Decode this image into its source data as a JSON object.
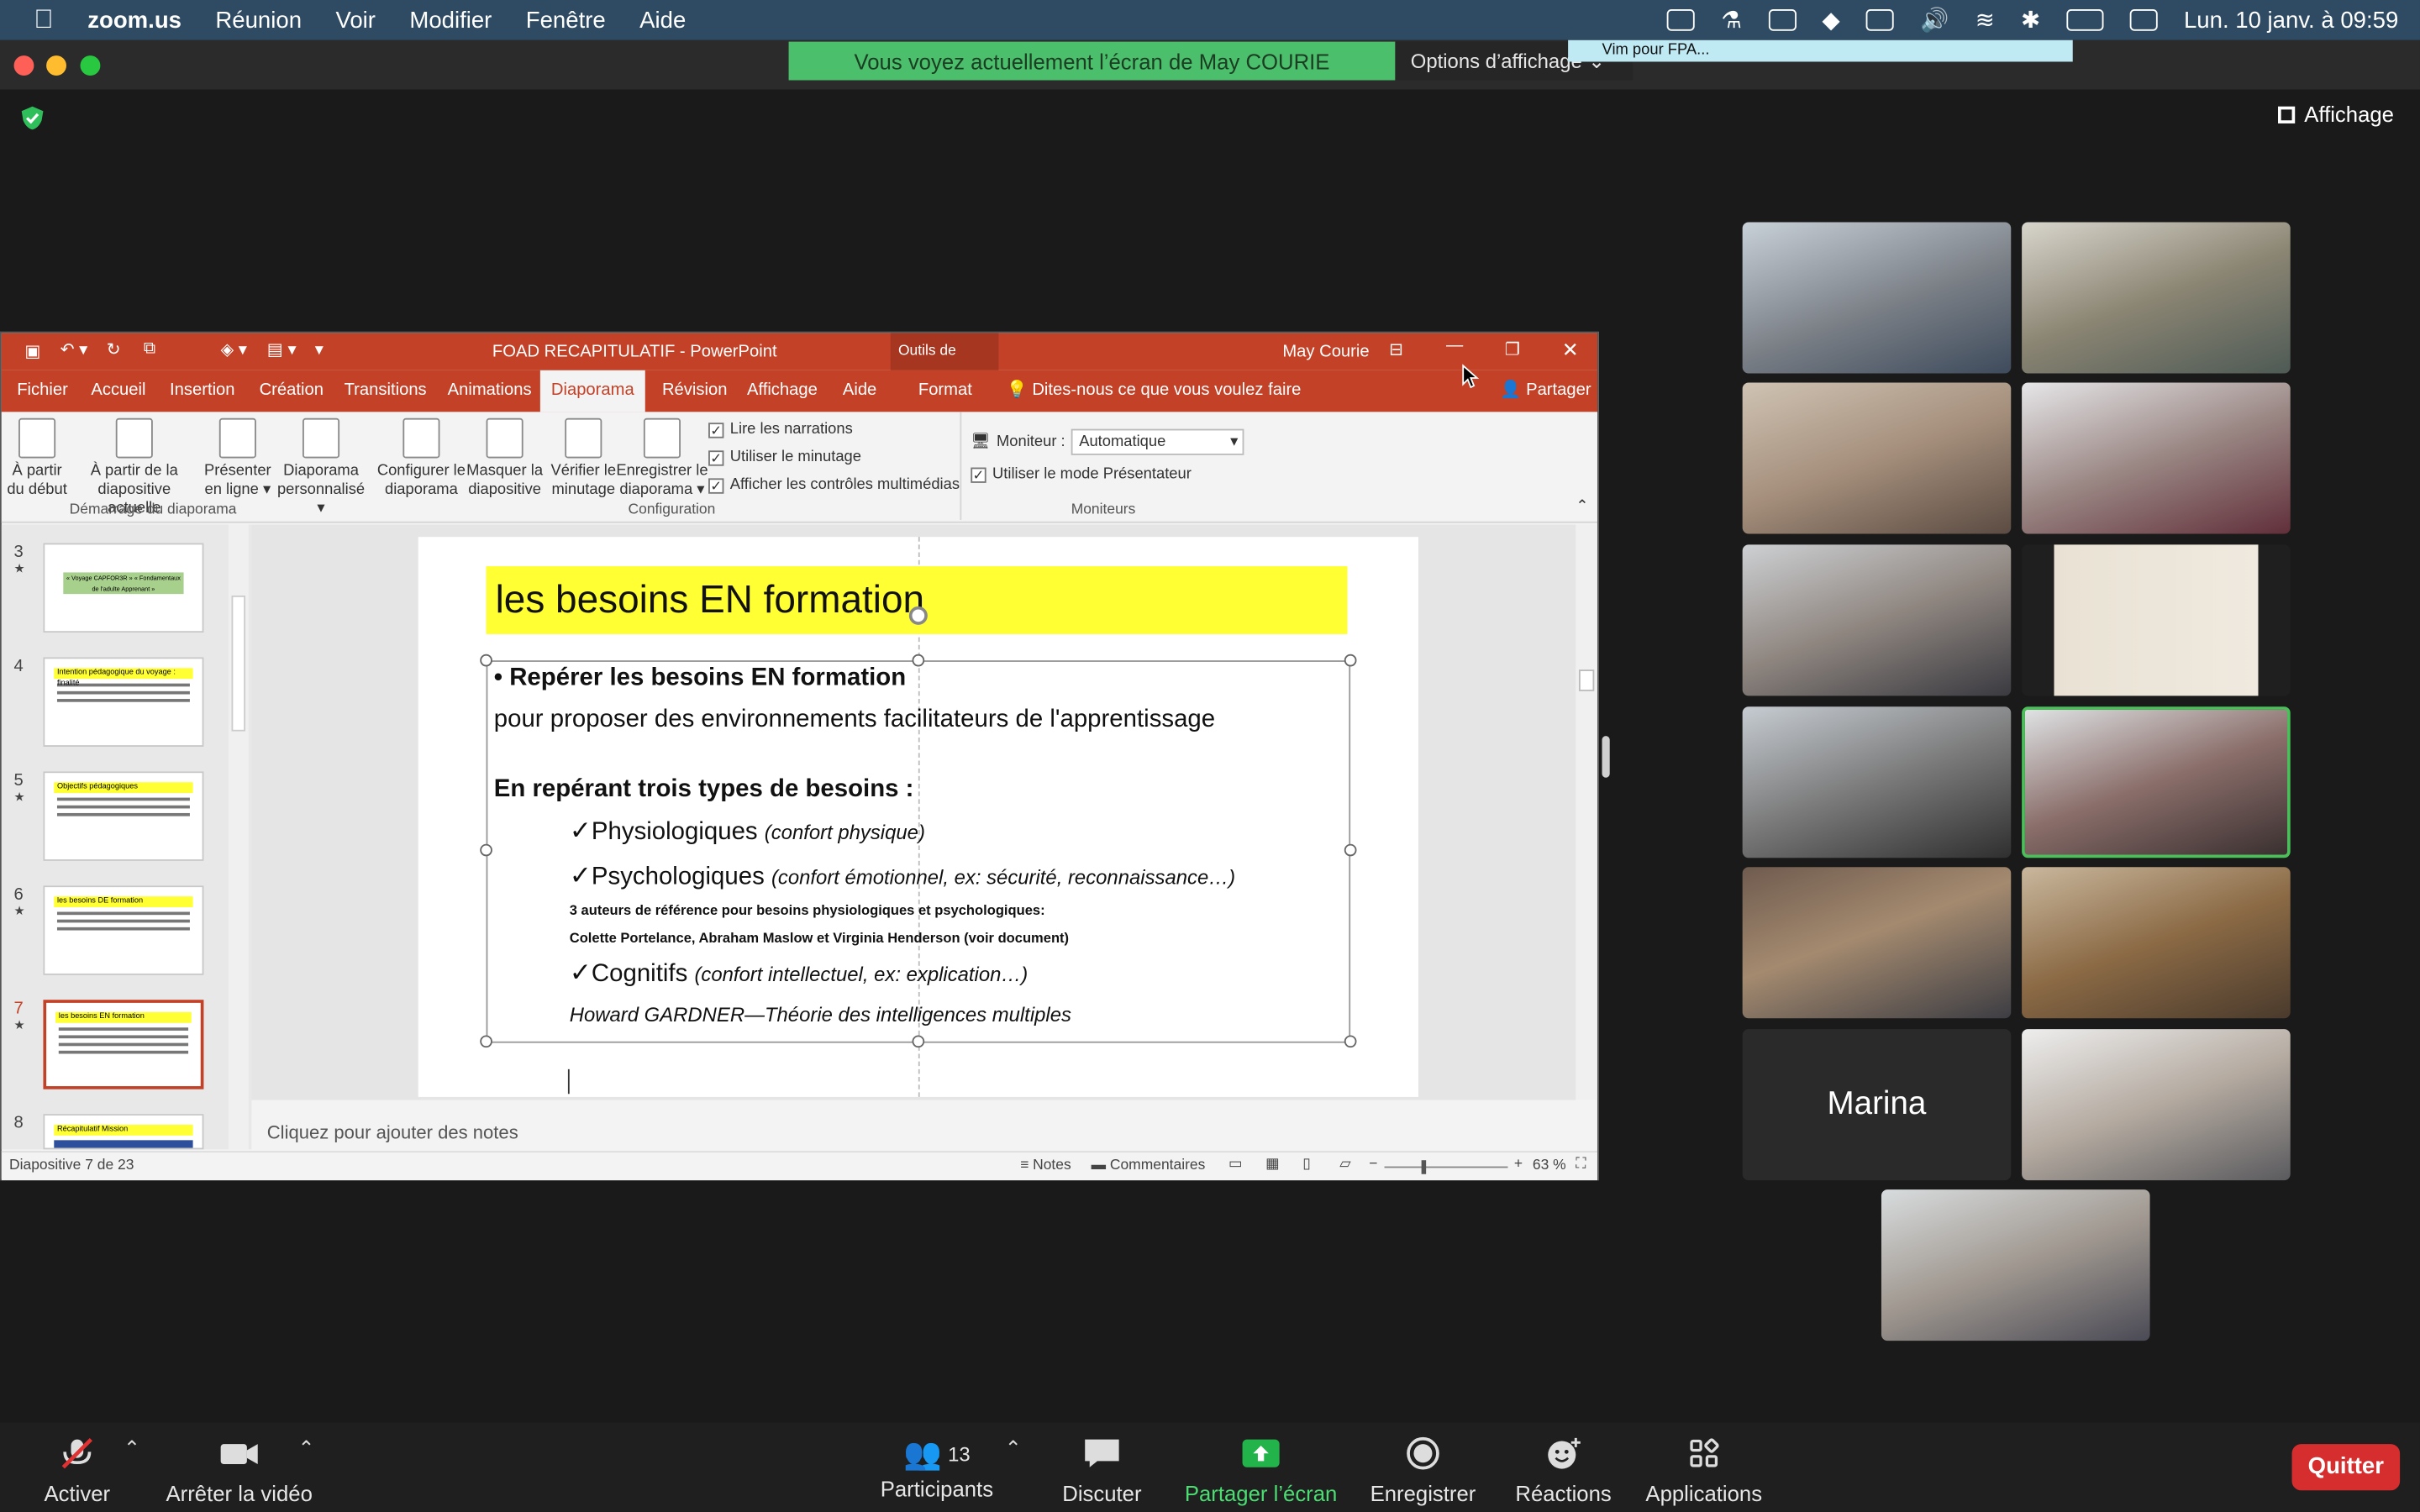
{
  "menubar": {
    "app": "zoom.us",
    "items": [
      "Réunion",
      "Voir",
      "Modifier",
      "Fenêtre",
      "Aide"
    ],
    "clock": "Lun. 10 janv. à  09:59"
  },
  "zoom": {
    "share_banner": "Vous voyez actuellement l’écran de May COURIE",
    "view_options": "Options d’affichage",
    "vim_tooltip": "Vim pour FPA...",
    "view_button": "Affichage",
    "participant_count": "13",
    "named_tile": "Marina",
    "toolbar": {
      "mute": "Activer",
      "video": "Arrêter la vidéo",
      "participants": "Participants",
      "chat": "Discuter",
      "share": "Partager l’écran",
      "record": "Enregistrer",
      "reactions": "Réactions",
      "apps": "Applications",
      "quit": "Quitter"
    }
  },
  "ppt": {
    "title": "FOAD RECAPITULATIF  -  PowerPoint",
    "context_tab": "Outils de dessin",
    "user": "May Courie",
    "share": "Partager",
    "tabs": [
      "Fichier",
      "Accueil",
      "Insertion",
      "Création",
      "Transitions",
      "Animations",
      "Diaporama",
      "Révision",
      "Affichage",
      "Aide",
      "Format"
    ],
    "tell_me": "Dites-nous ce que vous voulez faire",
    "ribbon": {
      "b1": [
        "À partir",
        "du début"
      ],
      "b2": [
        "À partir de la",
        "diapositive actuelle"
      ],
      "b3": [
        "Présenter",
        "en ligne ▾"
      ],
      "b4": [
        "Diaporama",
        "personnalisé ▾"
      ],
      "b5": [
        "Configurer le",
        "diaporama"
      ],
      "b6": [
        "Masquer la",
        "diapositive"
      ],
      "b7": [
        "Vérifier le",
        "minutage"
      ],
      "b8": [
        "Enregistrer le",
        "diaporama ▾"
      ],
      "chk1": "Lire les narrations",
      "chk2": "Utiliser le minutage",
      "chk3": "Afficher les contrôles multimédias",
      "monitor_label": "Moniteur :",
      "monitor_value": "Automatique",
      "presenter_mode": "Utiliser le mode Présentateur",
      "group1": "Démarrage du diaporama",
      "group2": "Configuration",
      "group3": "Moniteurs"
    },
    "thumbs": [
      {
        "n": "3",
        "title": "« Voyage CAPFOR3R » « Fondamentaux de l'adulte Apprenant »"
      },
      {
        "n": "4",
        "title": "Intention pédagogique du voyage : finalité"
      },
      {
        "n": "5",
        "title": "Objectifs pédagogiques"
      },
      {
        "n": "6",
        "title": "les besoins DE formation"
      },
      {
        "n": "7",
        "title": "les besoins EN formation"
      },
      {
        "n": "8",
        "title": "Récapitulatif Mission"
      }
    ],
    "slide": {
      "title": "les besoins EN formation",
      "bullet": "• Repérer les besoins EN formation",
      "line2": "pour proposer des environnements facilitateurs de l'apprentissage",
      "heading": "En repérant trois types de besoins :",
      "n1": "Physiologiques",
      "n1_note": "(confort physique)",
      "n2": "Psychologiques",
      "n2_note": "(confort émotionnel, ex: sécurité, reconnaissance…)",
      "ref1": "3 auteurs de référence pour besoins physiologiques et psychologiques:",
      "ref2": "Colette Portelance, Abraham Maslow et Virginia Henderson (voir document)",
      "n3": "Cognitifs",
      "n3_note": "(confort intellectuel, ex: explication…)",
      "gardner": "Howard GARDNER—Théorie des intelligences multiples",
      "check": "✓"
    },
    "notes_placeholder": "Cliquez pour ajouter des notes",
    "status": {
      "slide": "Diapositive 7 de 23",
      "notes": "Notes",
      "comments": "Commentaires",
      "zoom": "63 %"
    }
  },
  "colors": {
    "ppt_accent": "#c24127",
    "zoom_green": "#4bbf6b",
    "quit_red": "#d62e2e",
    "slide_title_bg": "#ffff33"
  }
}
